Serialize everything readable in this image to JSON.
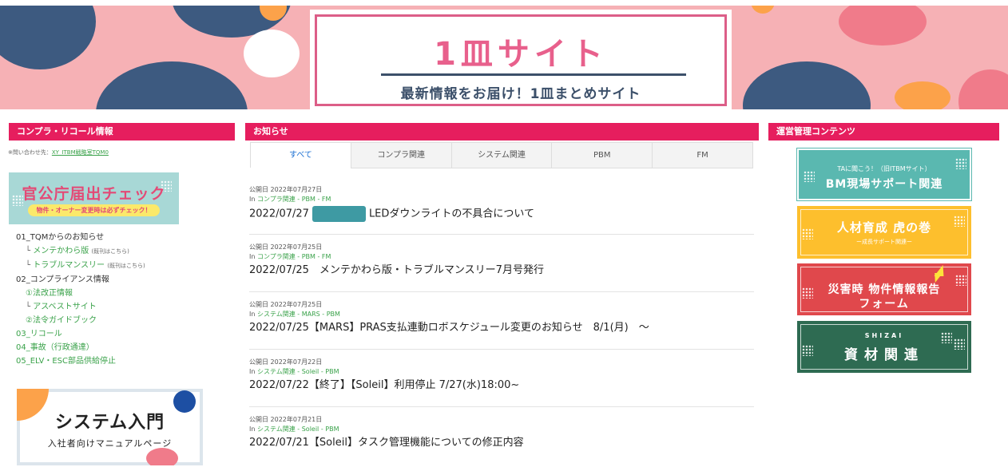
{
  "hero": {
    "title": "1皿サイト",
    "subtitle": "最新情報をお届け！1皿まとめサイト"
  },
  "left": {
    "header": "コンプラ・リコール情報",
    "contact_label": "※問い合わせ先：",
    "contact_link": "XY_ITBM戦略室TQM0",
    "banner_kanko": {
      "title": "官公庁届出チェック",
      "subtitle": "物件・オーナー変更時は必ずチェック！"
    },
    "nav": [
      {
        "label": "01_TQMからのお知らせ",
        "level": 0
      },
      {
        "prefix": "└",
        "label": "メンテかわら版",
        "note": "(既刊はこちら)",
        "level": 1
      },
      {
        "prefix": "└",
        "label": "トラブルマンスリー",
        "note": "(既刊はこちら)",
        "level": 1
      },
      {
        "label": "02_コンプライアンス情報",
        "level": 0
      },
      {
        "label": "①法改正情報",
        "level": 2
      },
      {
        "prefix": "└",
        "label": "アスベストサイト",
        "level": 1
      },
      {
        "label": "②法令ガイドブック",
        "level": 2
      },
      {
        "label": "03_リコール",
        "level": 3
      },
      {
        "label": "04_事故（行政通達）",
        "level": 3
      },
      {
        "label": "05_ELV・ESC部品供給停止",
        "level": 3
      }
    ],
    "banner_sys": {
      "title": "システム入門",
      "subtitle": "入社者向けマニュアルページ"
    }
  },
  "center": {
    "header": "お知らせ",
    "tabs": [
      "すべて",
      "コンプラ関連",
      "システム関連",
      "PBM",
      "FM"
    ],
    "active_tab": 0,
    "news": [
      {
        "date": "公開日 2022年07月27日",
        "in": "In",
        "cat": "コンプラ関連 - PBM - FM",
        "title_pre": "2022/07/27",
        "redacted": true,
        "title": "LEDダウンライトの不具合について"
      },
      {
        "date": "公開日 2022年07月25日",
        "in": "In",
        "cat": "コンプラ関連 - PBM - FM",
        "title_pre": "",
        "redacted": false,
        "title": "2022/07/25　メンテかわら版・トラブルマンスリー7月号発行"
      },
      {
        "date": "公開日 2022年07月25日",
        "in": "In",
        "cat": "システム関連 - MARS - PBM",
        "title_pre": "",
        "redacted": false,
        "title": "2022/07/25【MARS】PRAS支払連動ロボスケジュール変更のお知らせ　8/1(月)　～"
      },
      {
        "date": "公開日 2022年07月22日",
        "in": "In",
        "cat": "システム関連 - Soleil - PBM",
        "title_pre": "",
        "redacted": false,
        "title": "2022/07/22【終了】【Soleil】利用停止 7/27(水)18:00~"
      },
      {
        "date": "公開日 2022年07月21日",
        "in": "In",
        "cat": "システム関連 - Soleil - PBM",
        "title_pre": "",
        "redacted": false,
        "title": "2022/07/21【Soleil】タスク管理機能についての修正内容"
      }
    ]
  },
  "right": {
    "header": "運営管理コンテンツ",
    "banners": [
      {
        "small": "TAに聞こう！（旧ITBMサイト）",
        "main": "BM現場サポート関連"
      },
      {
        "main": "人材育成 虎の巻",
        "small": "ー成長サポート関連ー"
      },
      {
        "main": "災害時 物件情報報告",
        "main2": "フォーム"
      },
      {
        "small": "SHIZAI",
        "main": "資材関連"
      }
    ]
  },
  "colors": {
    "accent": "#e61e5e",
    "link_green": "#3aa24a",
    "hero_pink": "#f6b1b5",
    "tab_active": "#1a6fd2"
  }
}
